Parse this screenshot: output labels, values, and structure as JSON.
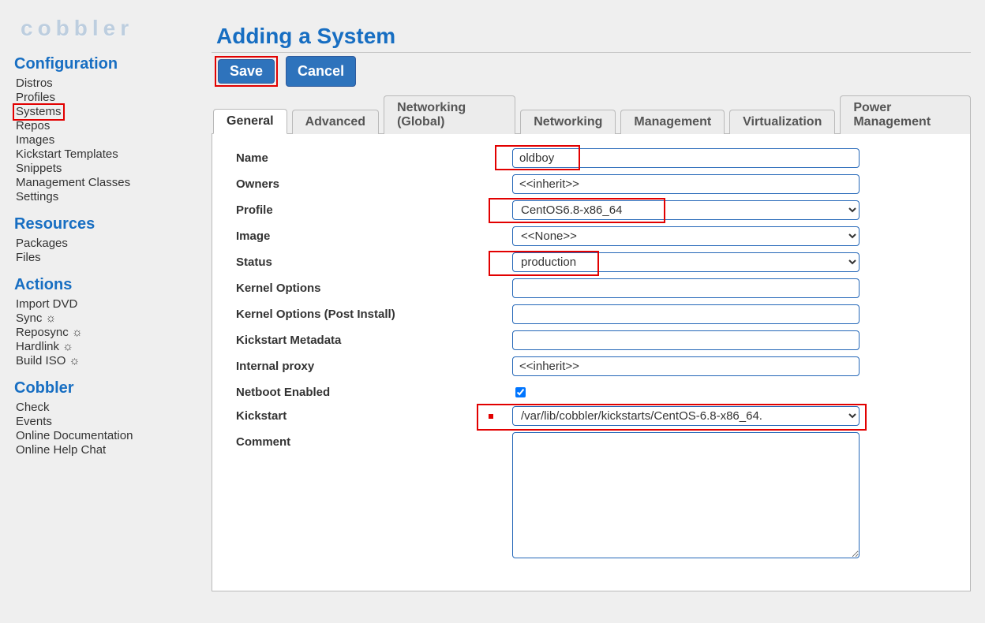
{
  "logo": "cobbler",
  "sidebar": {
    "configuration": {
      "heading": "Configuration",
      "items": [
        "Distros",
        "Profiles",
        "Systems",
        "Repos",
        "Images",
        "Kickstart Templates",
        "Snippets",
        "Management Classes",
        "Settings"
      ]
    },
    "resources": {
      "heading": "Resources",
      "items": [
        "Packages",
        "Files"
      ]
    },
    "actions": {
      "heading": "Actions",
      "items": [
        "Import DVD",
        "Sync ☼",
        "Reposync ☼",
        "Hardlink ☼",
        "Build ISO ☼"
      ]
    },
    "cobbler": {
      "heading": "Cobbler",
      "items": [
        "Check",
        "Events",
        "Online Documentation",
        "Online Help Chat"
      ]
    }
  },
  "title": "Adding a System",
  "buttons": {
    "save": "Save",
    "cancel": "Cancel"
  },
  "tabs": [
    "General",
    "Advanced",
    "Networking (Global)",
    "Networking",
    "Management",
    "Virtualization",
    "Power Management"
  ],
  "form": {
    "labels": {
      "name": "Name",
      "owners": "Owners",
      "profile": "Profile",
      "image": "Image",
      "status": "Status",
      "kopts": "Kernel Options",
      "kopts_post": "Kernel Options (Post Install)",
      "ksmeta": "Kickstart Metadata",
      "proxy": "Internal proxy",
      "netboot": "Netboot Enabled",
      "kickstart": "Kickstart",
      "comment": "Comment"
    },
    "values": {
      "name": "oldboy",
      "owners": "<<inherit>>",
      "profile": "CentOS6.8-x86_64",
      "image": "<<None>>",
      "status": "production",
      "kopts": "",
      "kopts_post": "",
      "ksmeta": "",
      "proxy": "<<inherit>>",
      "netboot_checked": true,
      "kickstart": "/var/lib/cobbler/kickstarts/CentOS-6.8-x86_64.",
      "comment": ""
    }
  }
}
